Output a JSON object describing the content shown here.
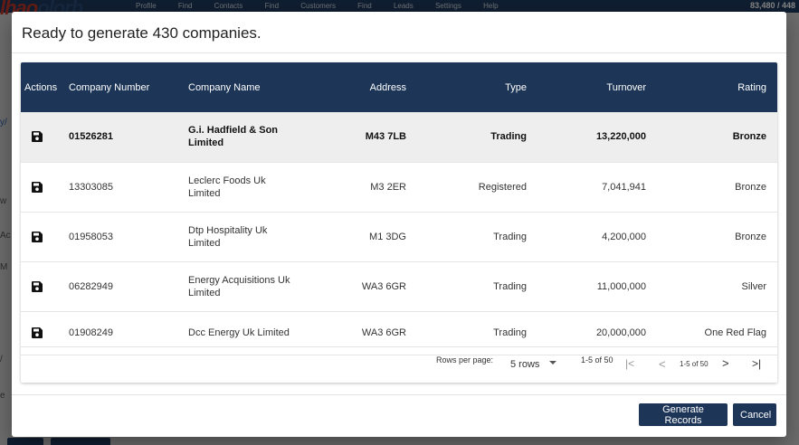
{
  "background": {
    "logo_part1": "lhao",
    "logo_part2": "olorb",
    "nav_text": "Profile Find Contacts Find Customers Find Leads Settings Help",
    "top_right": "83,480 / 448",
    "left_fragments": [
      "y/",
      "w",
      "Ac",
      "M",
      "/",
      "e"
    ]
  },
  "dialog": {
    "title": "Ready to generate 430 companies.",
    "columns": [
      "Actions",
      "Company Number",
      "Company Name",
      "Address",
      "Type",
      "Turnover",
      "Rating"
    ],
    "rows": [
      {
        "number": "01526281",
        "name": "G.i. Hadfield & Son Limited",
        "address": "M43 7LB",
        "type": "Trading",
        "turnover": "13,220,000",
        "rating": "Bronze"
      },
      {
        "number": "13303085",
        "name": "Leclerc Foods Uk Limited",
        "address": "M3 2ER",
        "type": "Registered",
        "turnover": "7,041,941",
        "rating": "Bronze"
      },
      {
        "number": "01958053",
        "name": "Dtp Hospitality Uk Limited",
        "address": "M1 3DG",
        "type": "Trading",
        "turnover": "4,200,000",
        "rating": "Bronze"
      },
      {
        "number": "06282949",
        "name": "Energy Acquisitions Uk Limited",
        "address": "WA3 6GR",
        "type": "Trading",
        "turnover": "11,000,000",
        "rating": "Silver"
      },
      {
        "number": "01908249",
        "name": "Dcc Energy Uk Limited",
        "address": "WA3 6GR",
        "type": "Trading",
        "turnover": "20,000,000",
        "rating": "One Red Flag"
      }
    ],
    "pagination": {
      "rows_per_page_label": "Rows per page:",
      "rows_per_page_value": "5 rows",
      "range": "1-5 of 50",
      "range_small": "1-5 of 50",
      "first": "|<",
      "prev": "<",
      "next": ">",
      "last": ">|"
    },
    "generate_label": "Generate Records",
    "cancel_label": "Cancel"
  }
}
